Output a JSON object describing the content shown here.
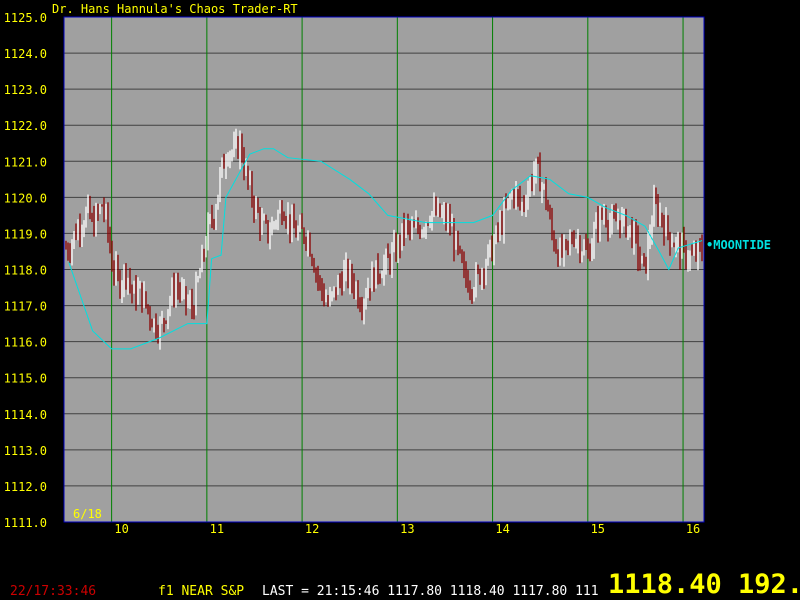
{
  "app": {
    "title": "Dr. Hans Hannula's Chaos Trader-RT"
  },
  "colors": {
    "background": "#000000",
    "plot_area": "#a0a0a0",
    "frame": "#0000c0",
    "gridline": "#404040",
    "day_line": "#008000",
    "axis_text": "#ffff00",
    "moontide": "#00e0e0",
    "bar_up": "#ffffff",
    "bar_down": "#8b0000",
    "clock_text": "#cc0000"
  },
  "chart_data": {
    "type": "bar",
    "title": "Dr. Hans Hannula's Chaos Trader-RT",
    "ylim": [
      1111.0,
      1125.0
    ],
    "y_ticks": [
      "1111.0",
      "1112.0",
      "1113.0",
      "1114.0",
      "1115.0",
      "1116.0",
      "1117.0",
      "1118.0",
      "1119.0",
      "1120.0",
      "1121.0",
      "1122.0",
      "1123.0",
      "1124.0",
      "1125.0"
    ],
    "xlim": [
      9.5,
      16.22
    ],
    "x_ticks": [
      "10",
      "11",
      "12",
      "13",
      "14",
      "15",
      "16"
    ],
    "date_label": "6/18",
    "grid": true,
    "series": [
      {
        "name": "MOONTIDE",
        "x": [
          9.55,
          9.8,
          10.0,
          10.2,
          10.5,
          10.8,
          11.0,
          11.05,
          11.15,
          11.2,
          11.45,
          11.6,
          11.7,
          11.85,
          12.2,
          12.5,
          12.7,
          12.9,
          13.1,
          13.3,
          13.6,
          13.8,
          14.0,
          14.2,
          14.4,
          14.6,
          14.8,
          15.0,
          15.2,
          15.4,
          15.6,
          15.75,
          15.85,
          15.95,
          16.2
        ],
        "values": [
          1118.2,
          1116.3,
          1115.8,
          1115.8,
          1116.1,
          1116.5,
          1116.5,
          1118.3,
          1118.4,
          1120.0,
          1121.2,
          1121.35,
          1121.35,
          1121.1,
          1121.0,
          1120.5,
          1120.1,
          1119.5,
          1119.4,
          1119.3,
          1119.3,
          1119.3,
          1119.5,
          1120.2,
          1120.6,
          1120.5,
          1120.1,
          1120.0,
          1119.7,
          1119.5,
          1119.2,
          1118.5,
          1118.0,
          1118.6,
          1118.8
        ]
      }
    ],
    "price_bars_note": "intraday OHLC bars, white=up, dark red=down"
  },
  "status_bar": {
    "clock": "22/17:33:46",
    "symbol": "f1 NEAR S&P",
    "last_line": "LAST = 21:15:46 1117.80 1118.40 1117.80 111",
    "big_price": "1118.40 192."
  }
}
